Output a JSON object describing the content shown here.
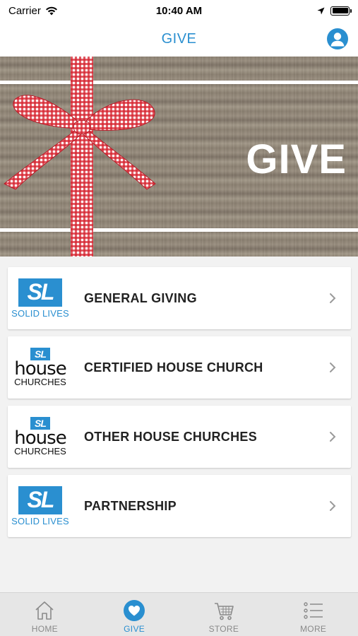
{
  "status_bar": {
    "carrier": "Carrier",
    "time": "10:40 AM"
  },
  "nav": {
    "title": "GIVE"
  },
  "banner": {
    "title": "GIVE"
  },
  "items": [
    {
      "label": "GENERAL GIVING",
      "logo": "solid-lives",
      "logo_text": "SL",
      "logo_caption": "SOLID LIVES"
    },
    {
      "label": "CERTIFIED HOUSE CHURCH",
      "logo": "house-churches",
      "logo_text": "SL",
      "logo_word": "house",
      "logo_caption": "CHURCHES"
    },
    {
      "label": "OTHER HOUSE CHURCHES",
      "logo": "house-churches",
      "logo_text": "SL",
      "logo_word": "house",
      "logo_caption": "CHURCHES"
    },
    {
      "label": "PARTNERSHIP",
      "logo": "solid-lives",
      "logo_text": "SL",
      "logo_caption": "SOLID LIVES"
    }
  ],
  "tabs": [
    {
      "label": "HOME",
      "icon": "home-icon"
    },
    {
      "label": "GIVE",
      "icon": "heart-icon",
      "active": true
    },
    {
      "label": "STORE",
      "icon": "cart-icon"
    },
    {
      "label": "MORE",
      "icon": "list-icon"
    }
  ],
  "colors": {
    "accent": "#2a8fd0",
    "ribbon": "#d62430"
  }
}
